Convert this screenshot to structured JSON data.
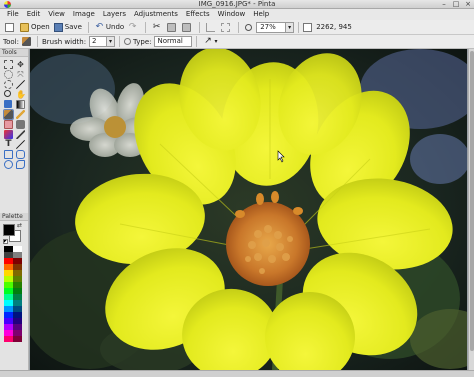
{
  "window": {
    "title": "IMG_0916.JPG* - Pinta",
    "app_icon": "pinta-icon",
    "controls": {
      "minimize": "–",
      "maximize": "□",
      "close": "×"
    }
  },
  "menu": [
    "File",
    "Edit",
    "View",
    "Image",
    "Layers",
    "Adjustments",
    "Effects",
    "Window",
    "Help"
  ],
  "toolbar": {
    "open_label": "Open",
    "save_label": "Save",
    "undo_label": "Undo",
    "zoom_value": "27%",
    "image_size": "2262, 945"
  },
  "tool_options": {
    "tool_label": "Tool:",
    "brush_width_label": "Brush width:",
    "brush_width_value": "2",
    "type_label": "Type:",
    "type_value": "Normal"
  },
  "panels": {
    "tools_title": "Tools",
    "palette_title": "Palette"
  },
  "colors": {
    "primary": "#000000",
    "secondary": "#ffffff",
    "flower_yellow": "#e6ec1c",
    "flower_center": "#c9772a"
  }
}
